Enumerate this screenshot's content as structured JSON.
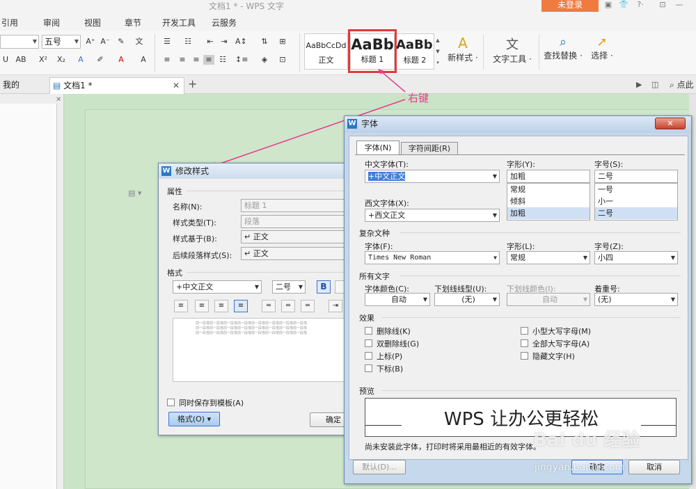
{
  "app": {
    "title": "文档1 * - WPS 文字",
    "login": "未登录"
  },
  "menu": [
    "引用",
    "审阅",
    "视图",
    "章节",
    "开发工具",
    "云服务"
  ],
  "ribbon": {
    "font_size": "五号",
    "styles": [
      {
        "preview": "AaBbCcDd",
        "name": "正文"
      },
      {
        "preview": "AaBb",
        "name": "标题 1"
      },
      {
        "preview": "AaBb(",
        "name": "标题 2"
      }
    ],
    "new_style": "新样式 ·",
    "text_tools": "文字工具 ·",
    "find_replace": "查找替换 ·",
    "select": "选择 ·"
  },
  "tabs": {
    "wps": "我的WPS",
    "doc": "文档1 *",
    "search": "点此"
  },
  "annotation": "右键",
  "modify_style": {
    "title": "修改样式",
    "props_header": "属性",
    "name_label": "名称(N):",
    "name_value": "标题 1",
    "type_label": "样式类型(T):",
    "type_value": "段落",
    "based_label": "样式基于(B):",
    "based_value": "↵ 正文",
    "next_label": "后续段落样式(S):",
    "next_value": "↵ 正文",
    "format_header": "格式",
    "font": "+中文正文",
    "size": "二号",
    "bold": "B",
    "preview_line": "前一段落前一段落前一段落前一段落前一段落前一段落前一段落前一段落",
    "save_template": "同时保存到模板(A)",
    "format_btn": "格式(O) ▾",
    "ok_btn": "确定"
  },
  "font_dialog": {
    "title": "字体",
    "tab_font": "字体(N)",
    "tab_spacing": "字符间距(R)",
    "cn_font_label": "中文字体(T):",
    "cn_font_value": "+中文正文",
    "style_label": "字形(Y):",
    "style_value": "加粗",
    "size_label": "字号(S):",
    "size_value": "二号",
    "style_list": [
      "常规",
      "倾斜",
      "加粗"
    ],
    "size_list": [
      "一号",
      "小一",
      "二号"
    ],
    "west_font_label": "西文字体(X):",
    "west_font_value": "+西文正文",
    "complex_header": "复杂文种",
    "complex_font_label": "字体(F):",
    "complex_font_value": "Times New Roman",
    "complex_style_label": "字形(L):",
    "complex_style_value": "常规",
    "complex_size_label": "字号(Z):",
    "complex_size_value": "小四",
    "all_header": "所有文字",
    "color_label": "字体颜色(C):",
    "color_value": "自动",
    "underline_label": "下划线线型(U):",
    "underline_value": "(无)",
    "ucolor_label": "下划线颜色(I):",
    "ucolor_value": "自动",
    "emph_label": "着重号:",
    "emph_value": "(无)",
    "effects_header": "效果",
    "effects_left": [
      "删除线(K)",
      "双删除线(G)",
      "上标(P)",
      "下标(B)"
    ],
    "effects_right": [
      "小型大写字母(M)",
      "全部大写字母(A)",
      "隐藏文字(H)"
    ],
    "preview_header": "预览",
    "preview_text": "WPS 让办公更轻松",
    "note": "尚未安装此字体，打印时将采用最相近的有效字体。",
    "default_btn": "默认(D)...",
    "ok_btn": "确定",
    "cancel_btn": "取消"
  },
  "watermark": {
    "brand": "Bai du 经验",
    "url": "jingyan.baidu.com"
  }
}
